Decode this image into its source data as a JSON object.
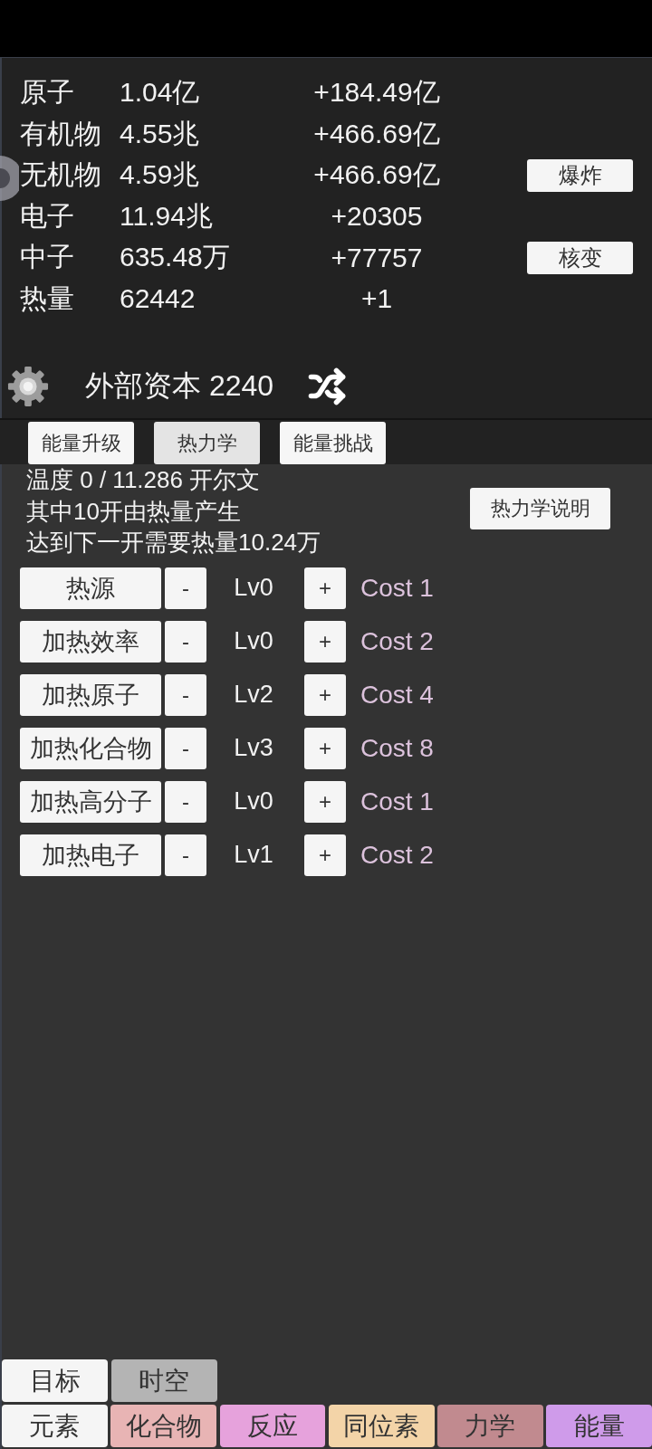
{
  "resources": [
    {
      "name": "原子",
      "amount": "1.04亿",
      "rate": "+184.49亿"
    },
    {
      "name": "有机物",
      "amount": "4.55兆",
      "rate": "+466.69亿"
    },
    {
      "name": "无机物",
      "amount": "4.59兆",
      "rate": "+466.69亿",
      "action": "爆炸"
    },
    {
      "name": "电子",
      "amount": "11.94兆",
      "rate": "+20305"
    },
    {
      "name": "中子",
      "amount": "635.48万",
      "rate": "+77757",
      "action": "核变"
    },
    {
      "name": "热量",
      "amount": "62442",
      "rate": "+1"
    }
  ],
  "capital": "外部资本 2240",
  "tabs": [
    {
      "label": "能量升级",
      "selected": false
    },
    {
      "label": "热力学",
      "selected": true
    },
    {
      "label": "能量挑战",
      "selected": false
    }
  ],
  "thermo": {
    "lines": [
      "温度 0 / 11.286 开尔文",
      "其中10开由热量产生",
      "达到下一开需要热量10.24万"
    ],
    "help_button": "热力学说明"
  },
  "upgrades": [
    {
      "name": "热源",
      "decrease": "-",
      "level": "Lv0",
      "increase": "+",
      "cost": "Cost 1"
    },
    {
      "name": "加热效率",
      "decrease": "-",
      "level": "Lv0",
      "increase": "+",
      "cost": "Cost 2"
    },
    {
      "name": "加热原子",
      "decrease": "-",
      "level": "Lv2",
      "increase": "+",
      "cost": "Cost 4"
    },
    {
      "name": "加热化合物",
      "decrease": "-",
      "level": "Lv3",
      "increase": "+",
      "cost": "Cost 8"
    },
    {
      "name": "加热高分子",
      "decrease": "-",
      "level": "Lv0",
      "increase": "+",
      "cost": "Cost 1"
    },
    {
      "name": "加热电子",
      "decrease": "-",
      "level": "Lv1",
      "increase": "+",
      "cost": "Cost 2"
    }
  ],
  "bottom_nav": {
    "top_row": [
      {
        "label": "目标",
        "color": "#f5f5f5"
      },
      {
        "label": "时空",
        "color": "#b4b4b4"
      }
    ],
    "bottom_row": [
      {
        "label": "元素",
        "color": "#f5f5f5"
      },
      {
        "label": "化合物",
        "color": "#e8b4b4"
      },
      {
        "label": "反应",
        "color": "#e6a2dc"
      },
      {
        "label": "同位素",
        "color": "#f3d4a8"
      },
      {
        "label": "力学",
        "color": "#c18a8f"
      },
      {
        "label": "能量",
        "color": "#cf9bea"
      }
    ]
  }
}
